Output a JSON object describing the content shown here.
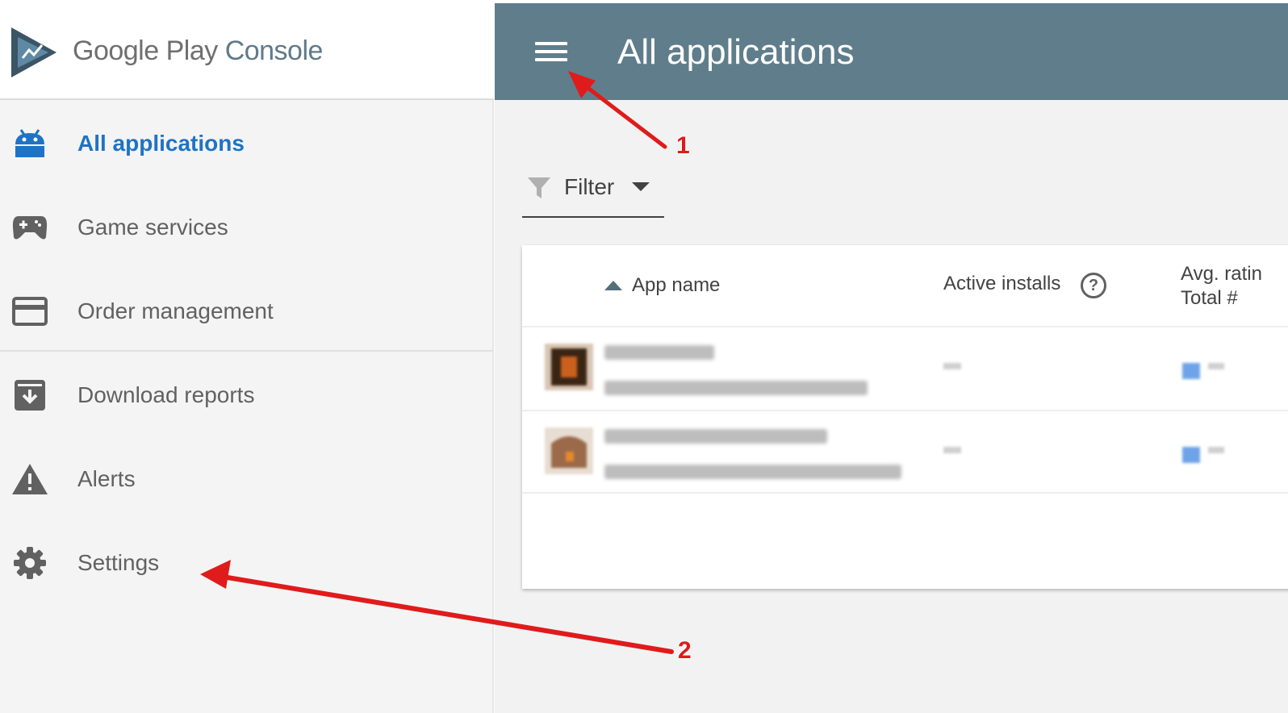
{
  "brand": {
    "google": "Google",
    "play": "Play",
    "console": "Console"
  },
  "header": {
    "title": "All applications"
  },
  "sidebar": {
    "items": [
      {
        "label": "All applications",
        "icon": "android-icon"
      },
      {
        "label": "Game services",
        "icon": "gamepad-icon"
      },
      {
        "label": "Order management",
        "icon": "credit-card-icon"
      },
      {
        "label": "Download reports",
        "icon": "download-box-icon"
      },
      {
        "label": "Alerts",
        "icon": "warning-icon"
      },
      {
        "label": "Settings",
        "icon": "gear-icon"
      }
    ]
  },
  "filter": {
    "label": "Filter"
  },
  "table": {
    "columns": {
      "app_name": "App name",
      "active_installs": "Active installs",
      "avg_rating_line1": "Avg. ratin",
      "avg_rating_line2": "Total #"
    },
    "help_symbol": "?"
  },
  "annotations": [
    "1",
    "2"
  ],
  "colors": {
    "header": "#607d8b",
    "active": "#1f73c5",
    "annotation": "#e01b1b"
  }
}
